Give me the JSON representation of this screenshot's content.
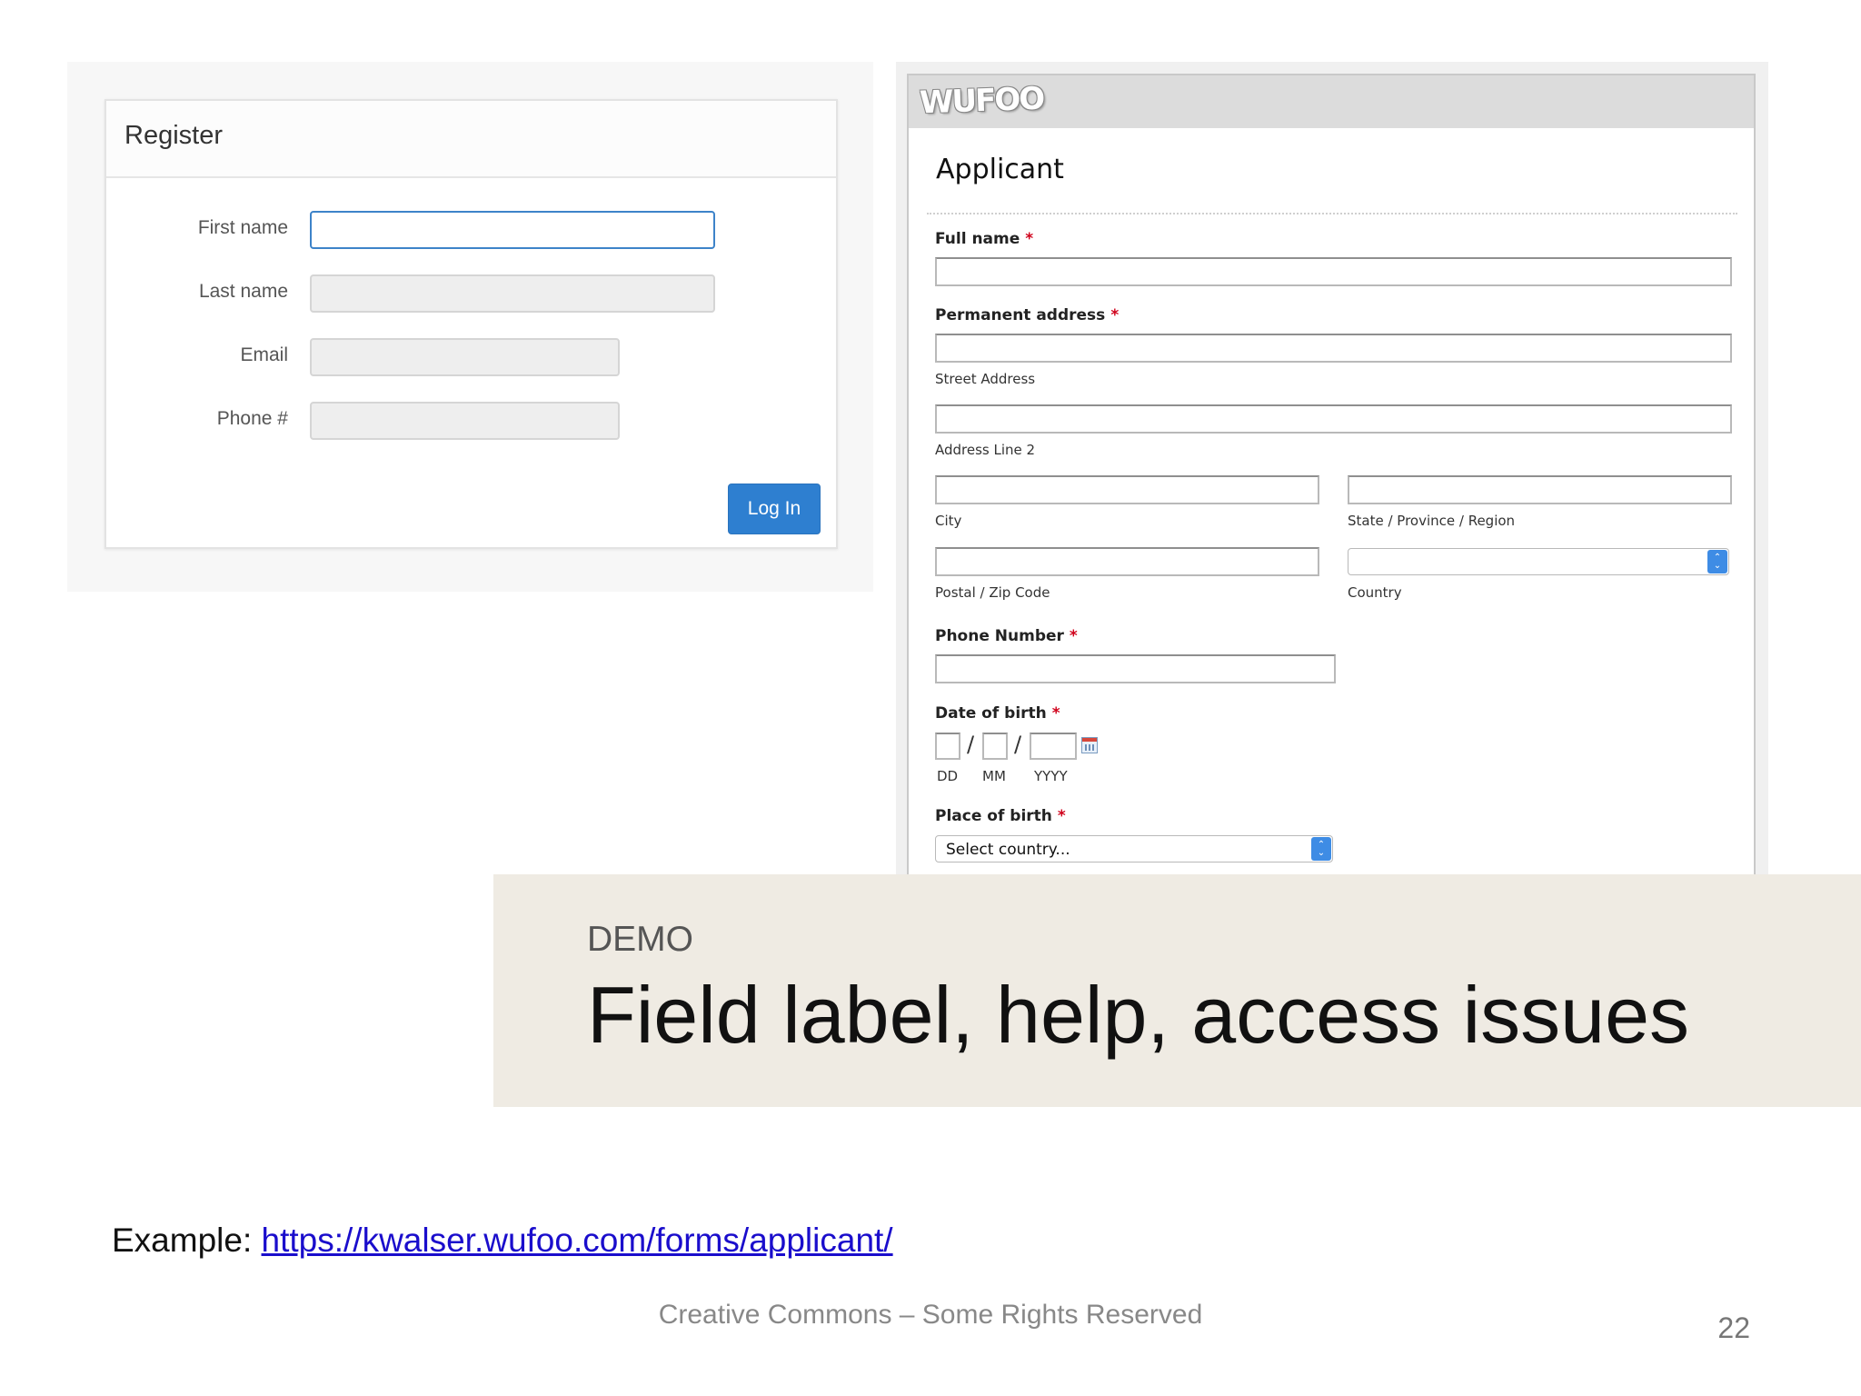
{
  "register": {
    "title": "Register",
    "fields": [
      {
        "label": "First name",
        "value": ""
      },
      {
        "label": "Last name",
        "value": ""
      },
      {
        "label": "Email",
        "value": ""
      },
      {
        "label": "Phone #",
        "value": ""
      }
    ],
    "submit_label": "Log In"
  },
  "wufoo": {
    "logo_text": "WUFOO",
    "form_title": "Applicant",
    "full_name_label": "Full name",
    "address_label": "Permanent address",
    "required_mark": "*",
    "street_sub": "Street Address",
    "line2_sub": "Address Line 2",
    "city_sub": "City",
    "state_sub": "State / Province / Region",
    "postal_sub": "Postal / Zip Code",
    "country_sub": "Country",
    "country_value": "",
    "phone_label": "Phone Number",
    "dob_label": "Date of birth",
    "dob_sep": "/",
    "dob_dd": "DD",
    "dob_mm": "MM",
    "dob_yyyy": "YYYY",
    "pob_label": "Place of birth",
    "pob_value": "Select country..."
  },
  "banner": {
    "kicker": "DEMO",
    "title": "Field label, help, access issues"
  },
  "footer": {
    "example_prefix": "Example: ",
    "example_link": "https://kwalser.wufoo.com/forms/applicant/",
    "credit": "Creative Commons – Some Rights Reserved",
    "page_number": "22"
  }
}
